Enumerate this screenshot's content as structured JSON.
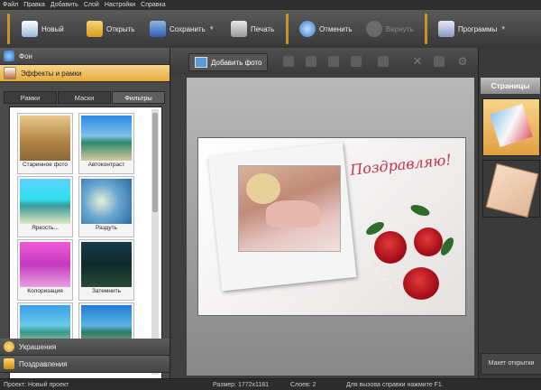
{
  "menu": [
    "Файл",
    "Правка",
    "Добавить",
    "Слой",
    "Настройки",
    "Справка"
  ],
  "toolbar": {
    "new": "Новый",
    "open": "Открыть",
    "save": "Сохранить",
    "print": "Печать",
    "undo": "Отменить",
    "redo": "Вернуть",
    "programs": "Программы"
  },
  "left_panel": {
    "sections": {
      "background": "Фон",
      "effects": "Эффекты и рамки",
      "decorations": "Украшения",
      "greetings": "Поздравления"
    },
    "subtabs": [
      "Рамки",
      "Маски",
      "Фильтры"
    ],
    "selected_subtab": "Фильтры",
    "filters": [
      {
        "label": "Старинное фото"
      },
      {
        "label": "Автоконтраст"
      },
      {
        "label": "Яркость..."
      },
      {
        "label": "Раздуть"
      },
      {
        "label": "Колоризация"
      },
      {
        "label": "Затемнить"
      },
      {
        "label": ""
      },
      {
        "label": ""
      }
    ]
  },
  "canvas": {
    "add_photo": "Добавить фото",
    "greeting_text": "Поздравляю!"
  },
  "right_panel": {
    "title": "Страницы",
    "layout_button": "Макет открытки"
  },
  "status": {
    "project": "Проект: Новый проект",
    "size": "Размер: 1772x1181",
    "layers": "Слоев: 2",
    "help": "Для вызова справки нажмите F1."
  },
  "colors": {
    "accent": "#e6aa3c",
    "greeting": "#c0334a"
  }
}
